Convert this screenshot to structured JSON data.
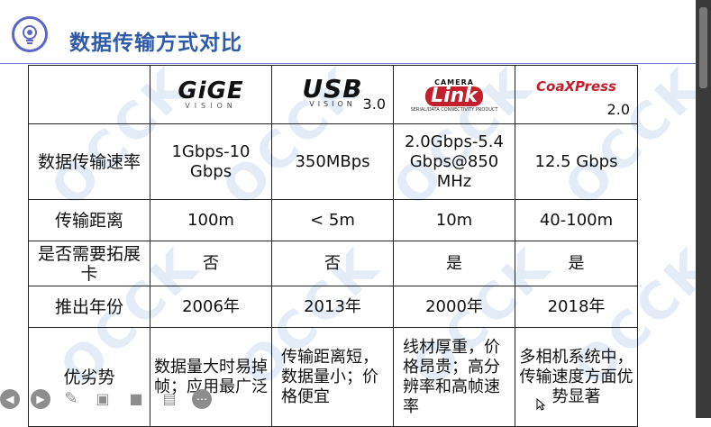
{
  "title": "数据传输方式对比",
  "columns": [
    {
      "brand_main": "GiGE",
      "brand_sub": "VISION"
    },
    {
      "brand_main": "USB",
      "brand_sub": "VISION",
      "version": "3.0"
    },
    {
      "brand_top": "CAMERA",
      "brand_main": "Link",
      "brand_sub": "SERIAL/DATA CONNECTIVITY PRODUCT"
    },
    {
      "brand_main": "CoaXPress",
      "version": "2.0"
    }
  ],
  "rows": [
    {
      "label": "数据传输速率",
      "cells": [
        "1Gbps-10 Gbps",
        "350MBps",
        "2.0Gbps-5.4 Gbps@850 MHz",
        "12.5 Gbps"
      ]
    },
    {
      "label": "传输距离",
      "cells": [
        "100m",
        "< 5m",
        "10m",
        "40-100m"
      ]
    },
    {
      "label": "是否需要拓展卡",
      "cells": [
        "否",
        "否",
        "是",
        "是"
      ]
    },
    {
      "label": "推出年份",
      "cells": [
        "2006年",
        "2013年",
        "2000年",
        "2018年"
      ]
    },
    {
      "label": "优劣势",
      "cells": [
        "数据量大时易掉帧；应用最广泛",
        "传输距离短，数据量小；价格便宜",
        "线材厚重，价格昂贵；高分辨率和高帧速率",
        "多相机系统中，传输速度方面优势显著"
      ]
    }
  ],
  "watermark_text": "OCCK",
  "toolbar": {
    "icons": [
      "prev-icon",
      "play-icon",
      "pen-icon",
      "screenshot-icon",
      "camera-icon",
      "comment-icon",
      "more-icon"
    ]
  }
}
